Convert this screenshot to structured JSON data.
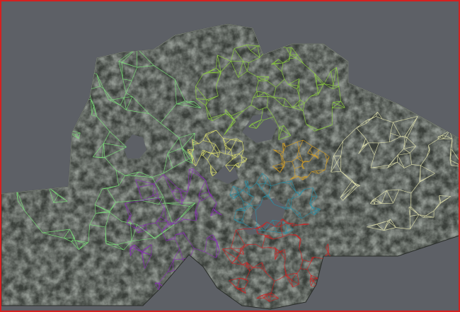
{
  "viewport": {
    "border_color": "#d42020",
    "background_color": "#5d6066"
  },
  "mesh": {
    "rock_color_dark": "#2a2e2a",
    "rock_color_mid": "#4a5048",
    "rock_color_light": "#9aa095",
    "regions": [
      {
        "name": "left-region",
        "color": "#7de87a"
      },
      {
        "name": "top-region",
        "color": "#8fd83a"
      },
      {
        "name": "center-region",
        "color": "#e4e86a"
      },
      {
        "name": "orange-region",
        "color": "#d8a020"
      },
      {
        "name": "right-region",
        "color": "#e8e8b0"
      },
      {
        "name": "cyan-region",
        "color": "#2890a8"
      },
      {
        "name": "purple-region",
        "color": "#8a2ab8"
      },
      {
        "name": "red-region",
        "color": "#d41e1e"
      }
    ]
  }
}
